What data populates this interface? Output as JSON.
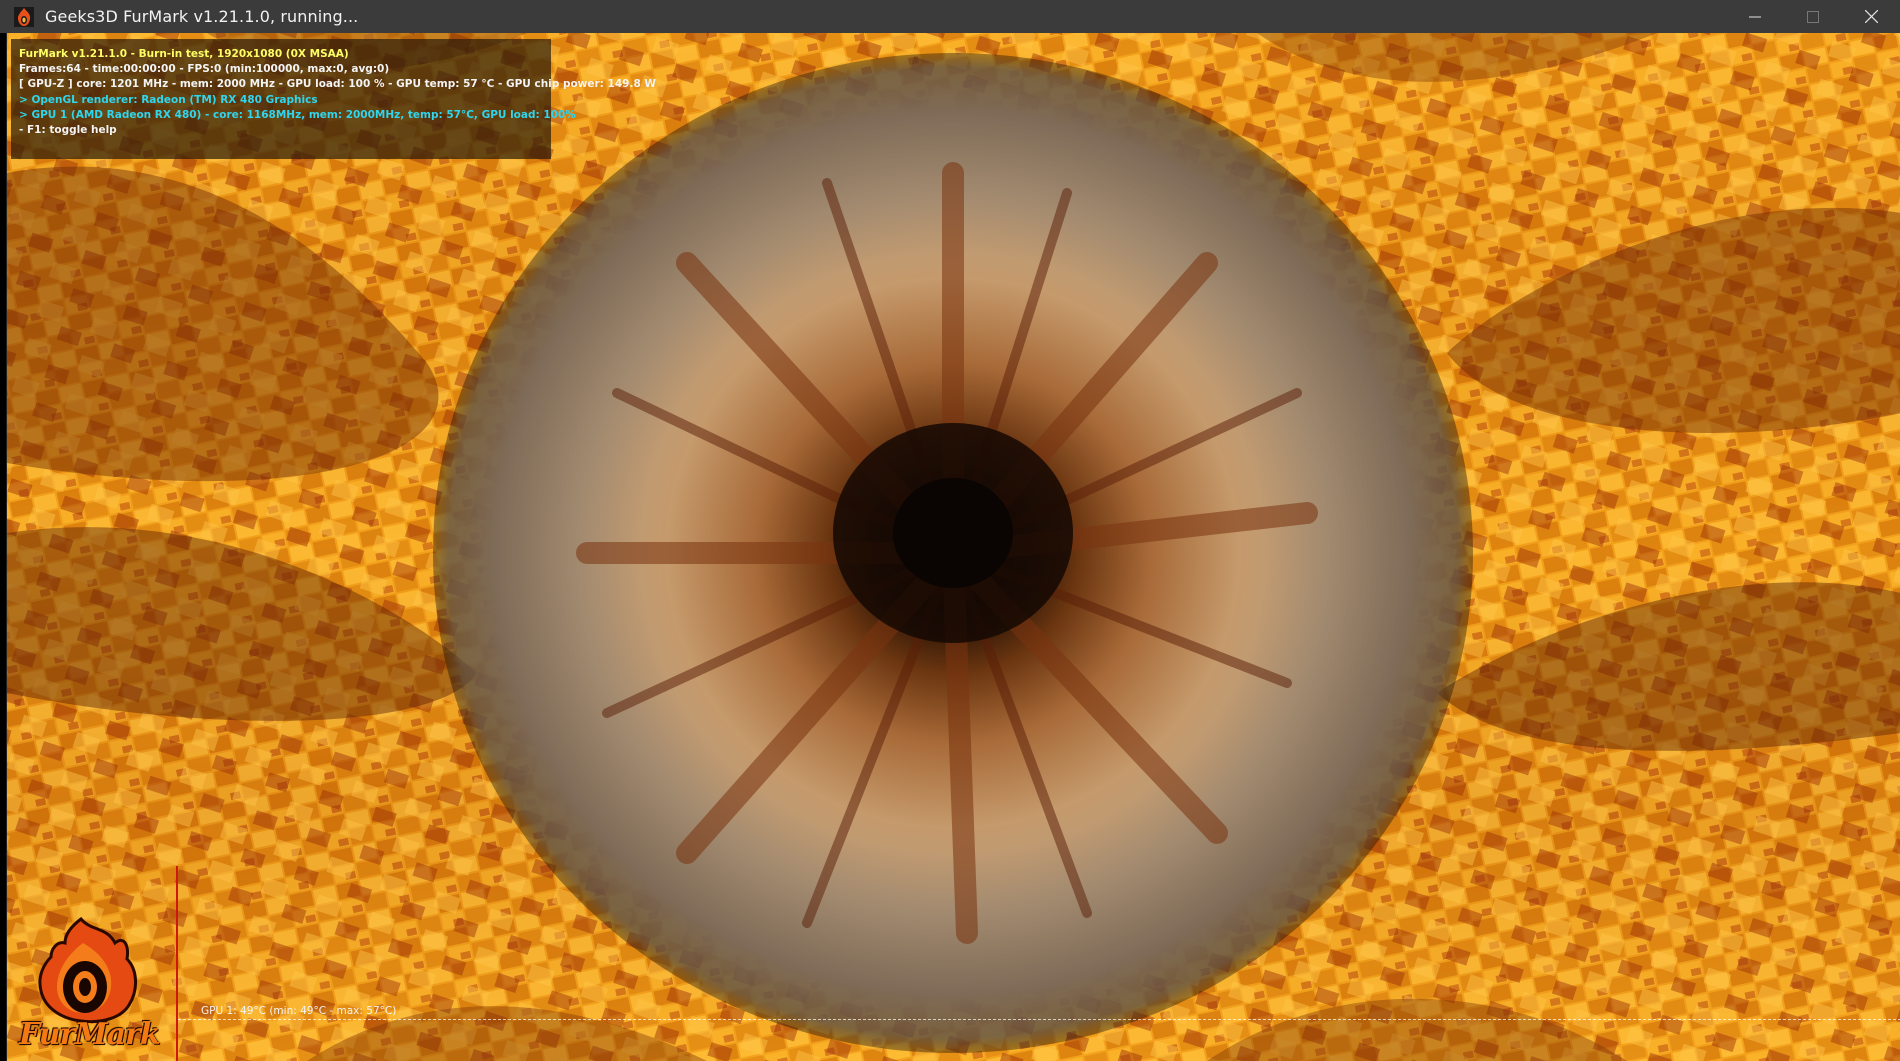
{
  "window": {
    "title": "Geeks3D FurMark v1.21.1.0, running...",
    "controls": {
      "minimize_icon": "minimize-icon",
      "maximize_icon": "maximize-icon",
      "close_icon": "close-icon"
    }
  },
  "overlay": {
    "lines": [
      {
        "text": "FurMark v1.21.1.0 - Burn-in test, 1920x1080 (0X MSAA)",
        "color": "#ffff66"
      },
      {
        "text": "Frames:64 - time:00:00:00 - FPS:0 (min:100000, max:0, avg:0)",
        "color": "#f4f4f4"
      },
      {
        "text": "[ GPU-Z ] core: 1201 MHz - mem: 2000 MHz - GPU load: 100 % - GPU temp: 57 °C - GPU chip power: 149.8 W",
        "color": "#f4f4f4"
      },
      {
        "text": "> OpenGL renderer: Radeon (TM) RX 480 Graphics",
        "color": "#2fd6ee"
      },
      {
        "text": "> GPU 1 (AMD Radeon RX 480) - core: 1168MHz, mem: 2000MHz, temp: 57°C, GPU load: 100%",
        "color": "#2fd6ee"
      },
      {
        "text": "- F1: toggle help",
        "color": "#f4f4f4"
      }
    ]
  },
  "graph": {
    "label": "GPU 1: 49°C (min: 49°C - max: 57°C)",
    "current_temp_c": 49,
    "min_temp_c": 49,
    "max_temp_c": 57
  },
  "logo": {
    "text": "FurMark",
    "icon": "furmark-flame-logo"
  },
  "colors": {
    "titlebar": "#3b3b3b",
    "accent_orange": "#f37a12",
    "overlay_title": "#ffff66",
    "overlay_info": "#2fd6ee",
    "graph_axis_y": "#cc1a10",
    "graph_axis_x": "#1a8fb8"
  }
}
